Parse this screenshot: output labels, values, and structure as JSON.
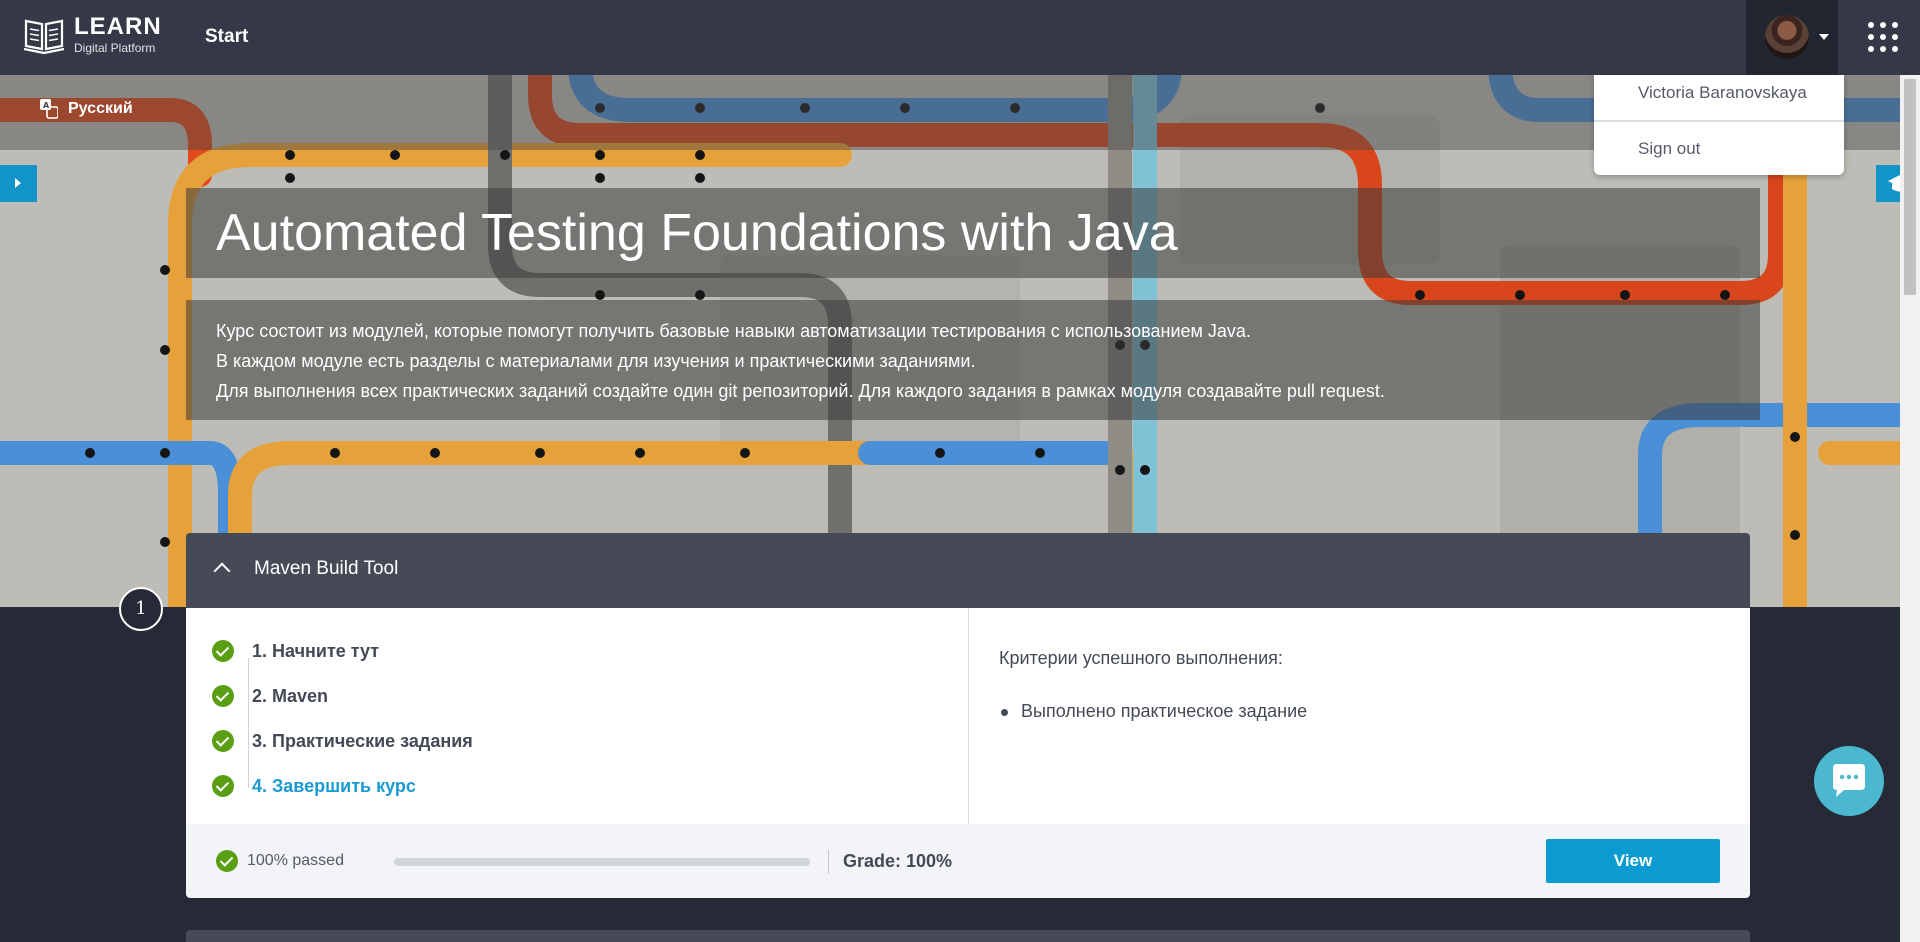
{
  "header": {
    "logo_title": "LEARN",
    "logo_subtitle": "Digital Platform",
    "nav_start": "Start",
    "icons": [
      "book-logo-icon",
      "caret-down-icon",
      "apps-grid-icon"
    ]
  },
  "user_menu": {
    "name": "Victoria Baranovskaya",
    "sign_out": "Sign out"
  },
  "language": {
    "label": "Русский",
    "icon": "translate-icon"
  },
  "course": {
    "title": "Automated Testing Foundations with Java",
    "description": [
      "Курс состоит из модулей, которые помогут получить базовые навыки автоматизации тестирования с использованием Java.",
      "В каждом модуле есть разделы с материалами для изучения и практическими заданиями.",
      "Для выполнения всех практических заданий создайте один git репозиторий. Для каждого задания в рамках модуля создавайте pull request."
    ]
  },
  "module": {
    "number": "1",
    "title": "Maven Build Tool",
    "lessons": [
      {
        "label": "1. Начните тут",
        "completed": true,
        "active": false
      },
      {
        "label": "2. Maven",
        "completed": true,
        "active": false
      },
      {
        "label": "3. Практические задания",
        "completed": true,
        "active": false
      },
      {
        "label": "4. Завершить курс",
        "completed": true,
        "active": true
      }
    ],
    "criteria_title": "Критерии успешного выполнения:",
    "criteria": [
      "Выполнено практическое задание"
    ],
    "passed_label": "100% passed",
    "progress_fraction": 1.0,
    "grade_label": "Grade: 100%",
    "view_button": "View"
  },
  "colors": {
    "topbar": "#353947",
    "accent": "#0b9bd1",
    "success": "#5a9e13",
    "module_header": "#464a57"
  }
}
